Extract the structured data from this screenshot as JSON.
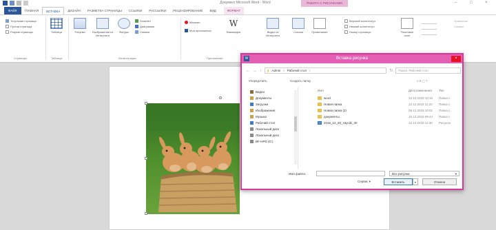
{
  "window": {
    "title": "Документ Microsoft Word - Word",
    "context_group": "РАБОТА С РИСУНКАМИ"
  },
  "tabs": [
    {
      "label": "ФАЙЛ",
      "kind": "file"
    },
    {
      "label": "ГЛАВНАЯ"
    },
    {
      "label": "ВСТАВКА",
      "kind": "active"
    },
    {
      "label": "ДИЗАЙН"
    },
    {
      "label": "РАЗМЕТКА СТРАНИЦЫ"
    },
    {
      "label": "ССЫЛКИ"
    },
    {
      "label": "РАССЫЛКИ"
    },
    {
      "label": "РЕЦЕНЗИРОВАНИЕ"
    },
    {
      "label": "ВИД"
    },
    {
      "label": "ФОРМАТ",
      "kind": "format"
    }
  ],
  "ribbon": {
    "pages": {
      "items": [
        "Титульная страница",
        "Пустая страница",
        "Разрыв страницы"
      ],
      "group": "Страницы"
    },
    "tables": {
      "label": "Таблица",
      "group": "Таблицы"
    },
    "illustrations": {
      "items": [
        "Рисунки",
        "Изображения из Интернета",
        "Фигуры",
        "SmartArt",
        "Диаграмма",
        "Снимок"
      ],
      "group": "Иллюстрации"
    },
    "addins": {
      "items": [
        "Магазин",
        "Мои приложения"
      ],
      "group": "Приложения"
    },
    "wikipedia": "Википедия",
    "video": "Видео из Интернета",
    "links": "Ссылки",
    "comment": "Примечание",
    "header_footer": [
      "Верхний колонтитул",
      "Нижний колонтитул",
      "Номер страницы"
    ],
    "textbox": "Текстовое поле",
    "symbols": [
      "Уравнение",
      "Символ"
    ]
  },
  "dialog": {
    "title": "Вставка рисунка",
    "address": [
      "Admin",
      "Рабочий стол"
    ],
    "search_placeholder": "Поиск: Рабочий стол",
    "organize": "Упорядочить",
    "new_folder": "Создать папку",
    "nav_items": [
      {
        "label": "Видео",
        "icon": "video-folder-icon"
      },
      {
        "label": "Документы",
        "icon": "documents-folder-icon"
      },
      {
        "label": "Загрузки",
        "icon": "downloads-folder-icon"
      },
      {
        "label": "Изображения",
        "icon": "pictures-folder-icon"
      },
      {
        "label": "Музыка",
        "icon": "music-folder-icon"
      },
      {
        "label": "Рабочий стол",
        "icon": "desktop-folder-icon"
      },
      {
        "label": "Локальный диск",
        "icon": "drive-icon"
      },
      {
        "label": "Локальный диск",
        "icon": "drive-icon"
      },
      {
        "label": "BF-HPD (D:)",
        "icon": "drive-icon"
      }
    ],
    "columns": {
      "name": "Имя",
      "date": "Дата изменения",
      "type": "Тип"
    },
    "files": [
      {
        "name": "word",
        "date": "12.12.2018 10:15",
        "type": "Папка с",
        "icon": "folder-icon"
      },
      {
        "name": "Новая папка",
        "date": "12.12.2018 11:22",
        "type": "Папка с",
        "icon": "folder-icon"
      },
      {
        "name": "Новая папка (2)",
        "date": "08.12.2018 10:01",
        "type": "Папка с",
        "icon": "folder-icon"
      },
      {
        "name": "документы",
        "date": "10.12.2018 09:44",
        "type": "Папка с",
        "icon": "folder-icon"
      },
      {
        "name": "2016_12_20_zayciki_30",
        "date": "12.12.2018 11:30",
        "type": "Рисунок",
        "icon": "image-file-icon"
      }
    ],
    "filename_label": "Имя файла:",
    "filetype": "Все рисунки",
    "service": "Сервис",
    "insert": "Вставить",
    "cancel": "Отмена"
  },
  "colors": {
    "accent": "#2b579a",
    "dialog_title": "#e35fb4",
    "dialog_border": "#d5399a",
    "folder": "#e8c04a"
  }
}
